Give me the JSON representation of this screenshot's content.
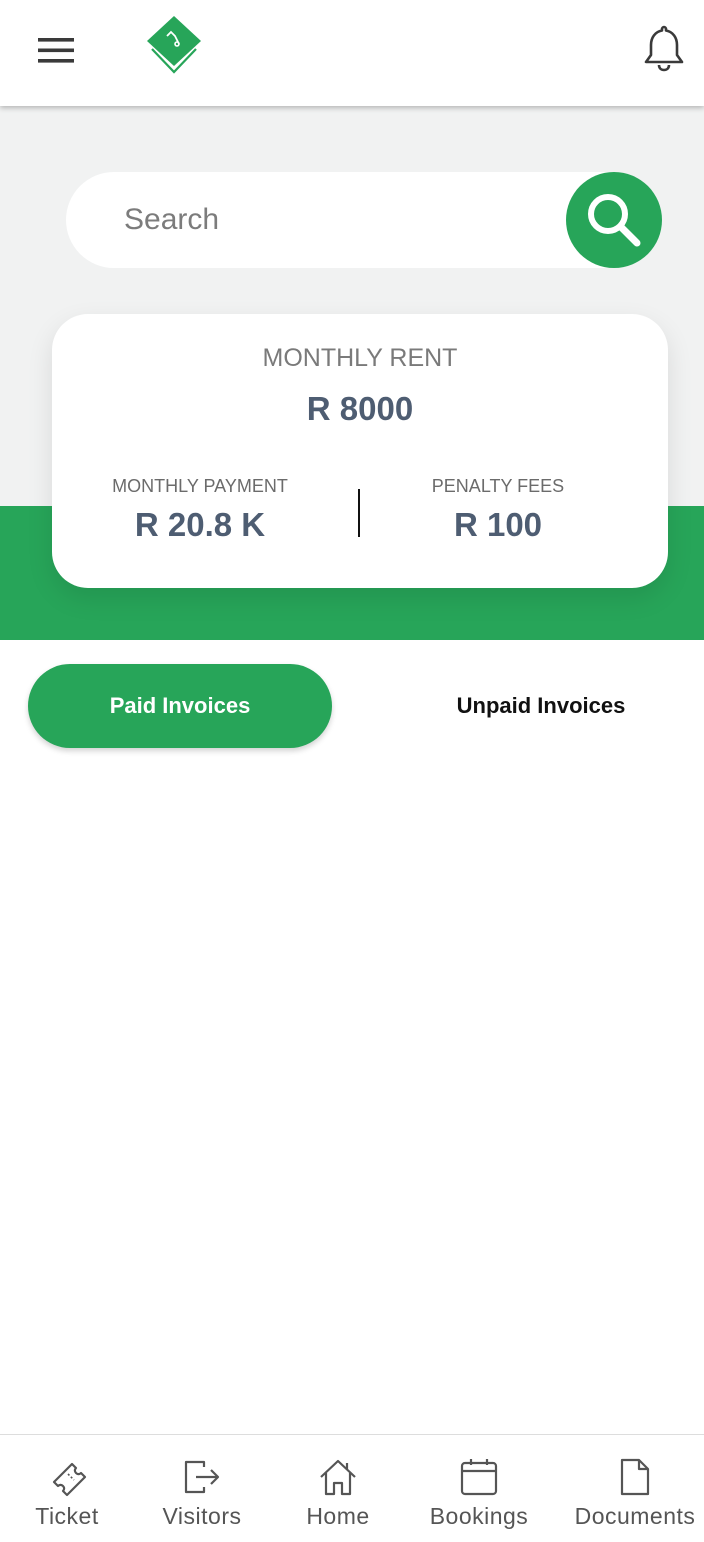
{
  "header": {
    "menu_icon": "hamburger-menu-icon",
    "logo_icon": "green-diamond-logo",
    "notification_icon": "bell-icon"
  },
  "search": {
    "placeholder": "Search",
    "button_icon": "search-icon"
  },
  "rent_card": {
    "title": "MONTHLY RENT",
    "value": "R 8000",
    "monthly_payment_label": "MONTHLY PAYMENT",
    "monthly_payment_value": "R 20.8 K",
    "penalty_fees_label": "PENALTY FEES",
    "penalty_fees_value": "R 100"
  },
  "tabs": {
    "paid_label": "Paid Invoices",
    "unpaid_label": "Unpaid Invoices",
    "active": "Paid Invoices"
  },
  "bottom_nav": {
    "items": [
      {
        "label": "Ticket",
        "icon": "ticket-icon"
      },
      {
        "label": "Visitors",
        "icon": "exit-arrow-icon"
      },
      {
        "label": "Home",
        "icon": "home-icon"
      },
      {
        "label": "Bookings",
        "icon": "calendar-icon"
      },
      {
        "label": "Documents",
        "icon": "document-icon"
      }
    ]
  },
  "colors": {
    "accent_green": "#27a559",
    "background_gray": "#f1f2f2",
    "value_slate": "#4e5d72"
  }
}
